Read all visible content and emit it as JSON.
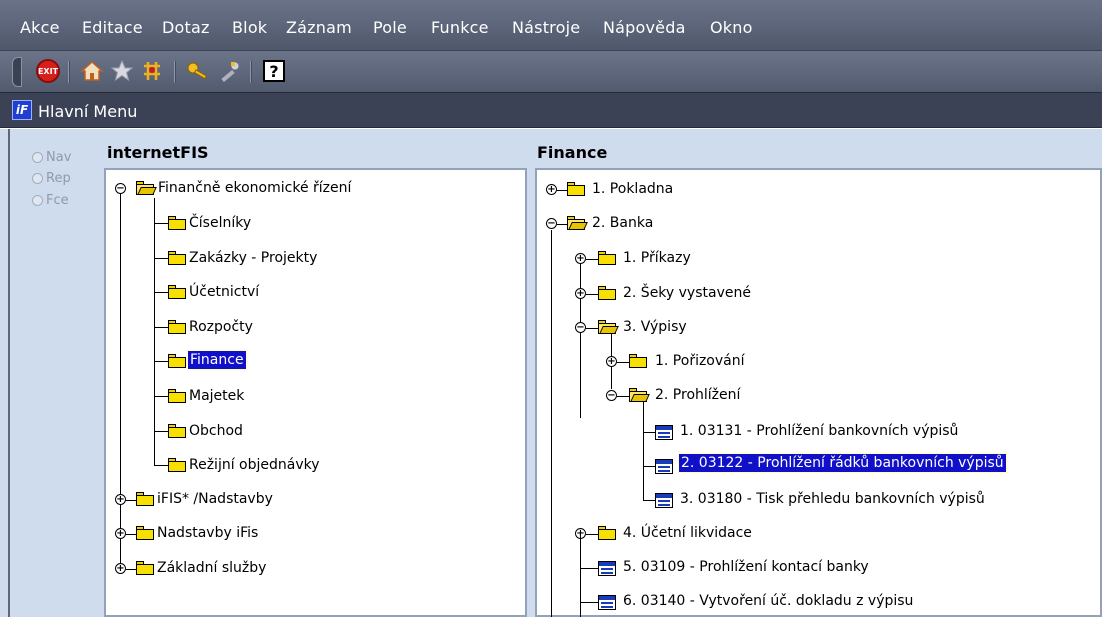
{
  "menubar": {
    "items": [
      "Akce",
      "Editace",
      "Dotaz",
      "Blok",
      "Záznam",
      "Pole",
      "Funkce",
      "Nástroje",
      "Nápověda",
      "Okno"
    ]
  },
  "toolbar": {
    "exit_label": "EXIT",
    "help_label": "?",
    "icons": [
      "exit-icon",
      "home-icon",
      "star-icon",
      "network-icon",
      "keys-icon",
      "tools-icon",
      "help-icon"
    ]
  },
  "window": {
    "title": "Hlavní Menu",
    "logo": "iF"
  },
  "mode": {
    "options": [
      "Nav",
      "Rep",
      "Fce"
    ]
  },
  "left_panel": {
    "title": "internetFIS",
    "root": "Finančně ekonomické řízení",
    "children": [
      "Číselníky",
      "Zakázky - Projekty",
      "Účetnictví",
      "Rozpočty",
      "Finance",
      "Majetek",
      "Obchod",
      "Režijní objednávky"
    ],
    "selected": "Finance",
    "siblings": [
      "iFIS* /Nadstavby",
      "Nadstavby iFis",
      "Základní služby"
    ]
  },
  "right_panel": {
    "title": "Finance",
    "items": [
      "1. Pokladna",
      "2. Banka",
      "1. Příkazy",
      "2. Šeky vystavené",
      "3. Výpisy",
      "1. Pořizování",
      "2. Prohlížení",
      "1. 03131 - Prohlížení bankovních výpisů",
      "2. 03122 - Prohlížení řádků bankovních výpisů",
      "3. 03180 - Tisk přehledu bankovních výpisů",
      "4. Účetní likvidace",
      "5. 03109 - Prohlížení kontací banky",
      "6. 03140 - Vytvoření úč. dokladu z výpisu"
    ],
    "selected": "2. 03122 - Prohlížení řádků bankovních výpisů"
  }
}
